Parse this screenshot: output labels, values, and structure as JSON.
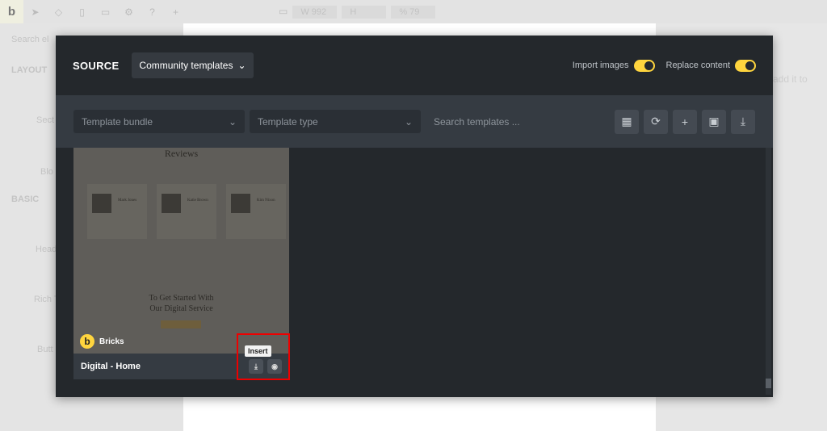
{
  "topbar": {
    "logo": "b",
    "width_label": "W",
    "width_value": "992",
    "height_label": "H",
    "scale_label": "%",
    "scale_value": "79"
  },
  "leftpanel": {
    "search_placeholder": "Search el",
    "layout": "LAYOUT",
    "items": [
      "Sect",
      "Blo"
    ],
    "basic": "BASIC",
    "basic_items": [
      "Head",
      "Rich T",
      "Butt"
    ]
  },
  "rightpanel": {
    "text": "add it to"
  },
  "modal": {
    "source_label": "SOURCE",
    "source_value": "Community templates",
    "import_images": "Import images",
    "replace_content": "Replace content",
    "import_images_on": true,
    "replace_content_on": true,
    "template_bundle": "Template bundle",
    "template_type": "Template type",
    "search_placeholder": "Search templates ...",
    "tools": [
      "grid-icon",
      "refresh-icon",
      "plus-icon",
      "save-icon",
      "download-icon"
    ]
  },
  "card": {
    "preview_heading": "Reviews",
    "people": [
      "Mark Jones",
      "Katie Brown",
      "Kim Nixon"
    ],
    "cta_line1": "To Get Started With",
    "cta_line2": "Our Digital Service",
    "author": "Bricks",
    "title": "Digital - Home",
    "tooltip": "Insert"
  },
  "colors": {
    "accent": "#ffd53e",
    "modal_bg": "#24282c",
    "highlight": "#e00000"
  }
}
